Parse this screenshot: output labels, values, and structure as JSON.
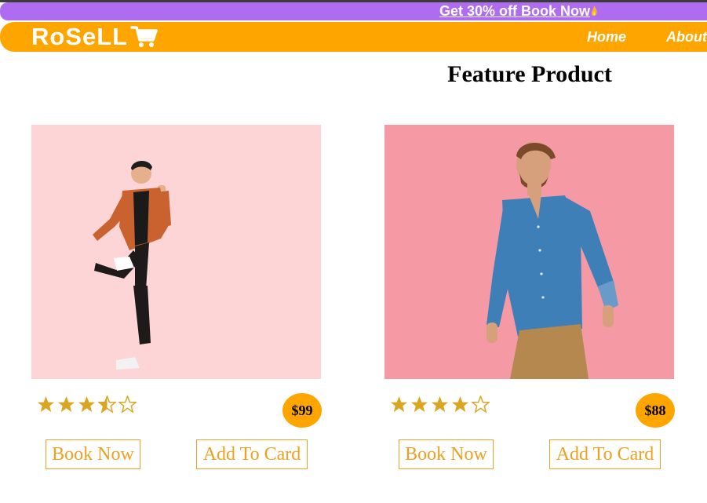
{
  "promo": {
    "text": "Get 30% off Book Now",
    "icon": "fire-icon"
  },
  "nav": {
    "logo": "RoSeLL",
    "links": [
      "Home",
      "About"
    ],
    "brand_color": "#ffa500",
    "promo_color": "#b06cf0"
  },
  "section": {
    "title": "Feature Product"
  },
  "products": [
    {
      "rating": 3.5,
      "rating_max": 5,
      "price": "$99",
      "book_label": "Book Now",
      "cart_label": "Add To Card",
      "photo": "man-orange-jacket-jumping",
      "photo_bg": "#fdd5d6"
    },
    {
      "rating": 4,
      "rating_max": 5,
      "price": "$88",
      "book_label": "Book Now",
      "cart_label": "Add To Card",
      "photo": "man-blue-shirt-walking",
      "photo_bg": "#f59aa4"
    }
  ],
  "colors": {
    "accent": "#ffa500",
    "star": "#daa520",
    "button_text": "#f0a020"
  }
}
